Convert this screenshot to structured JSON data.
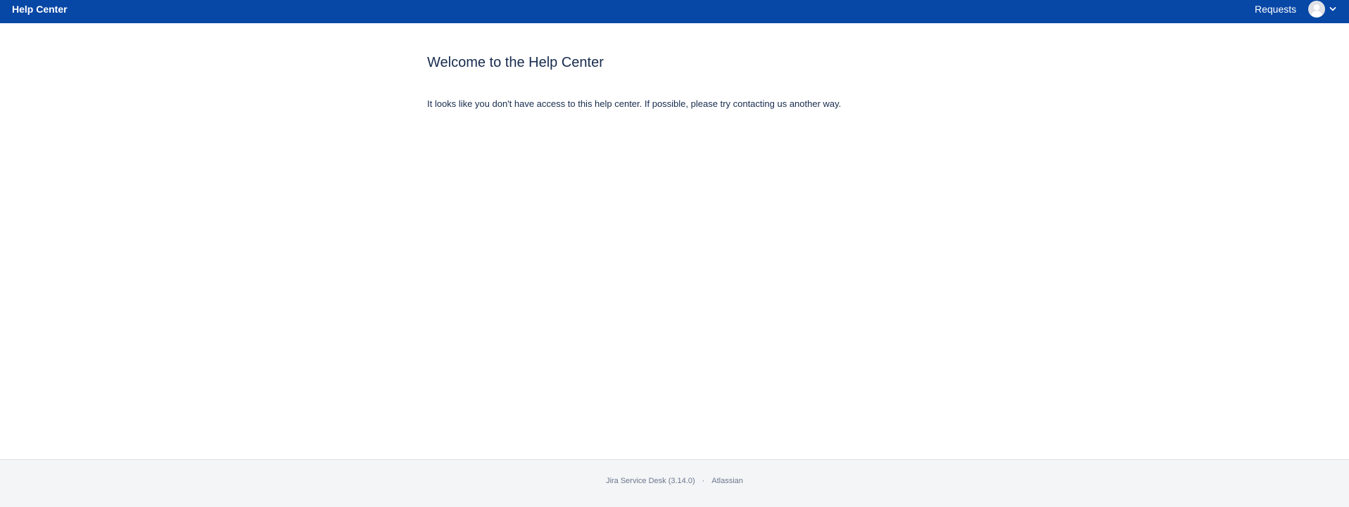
{
  "header": {
    "brand": "Help Center",
    "requests_label": "Requests",
    "icons": {
      "avatar": "user-avatar-icon",
      "menu": "chevron-down-icon"
    },
    "colors": {
      "bar": "#0747a6",
      "text": "#ffffff"
    }
  },
  "main": {
    "title": "Welcome to the Help Center",
    "message": "It looks like you don't have access to this help center. If possible, please try contacting us another way."
  },
  "footer": {
    "product": "Jira Service Desk (3.14.0)",
    "separator": "·",
    "vendor": "Atlassian"
  }
}
